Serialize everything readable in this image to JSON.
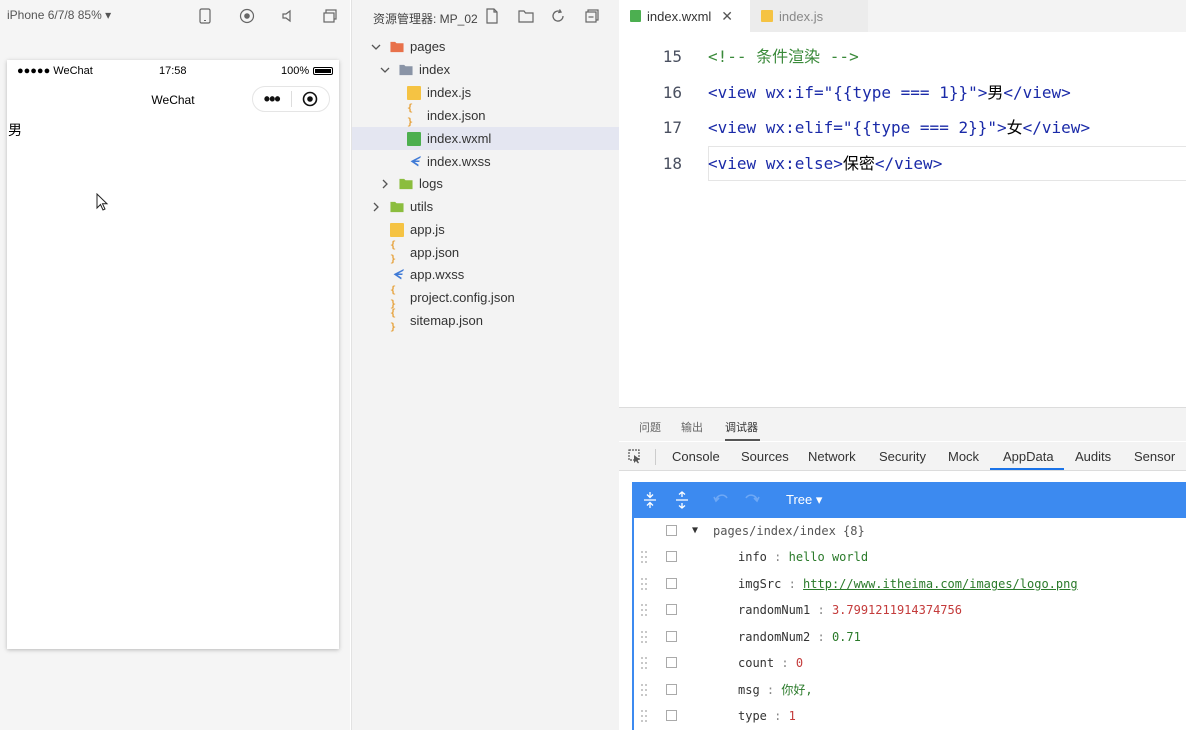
{
  "simulator": {
    "device_label": "iPhone 6/7/8 85% ▾",
    "status": {
      "signal": "●●●●● WeChat",
      "time": "17:58",
      "battery": "100%"
    },
    "nav_title": "WeChat",
    "page_text": "男"
  },
  "explorer": {
    "title": "资源管理器: MP_02",
    "tree": [
      {
        "label": "pages"
      },
      {
        "label": "index"
      },
      {
        "label": "index.js"
      },
      {
        "label": "index.json"
      },
      {
        "label": "index.wxml"
      },
      {
        "label": "index.wxss"
      },
      {
        "label": "logs"
      },
      {
        "label": "utils"
      },
      {
        "label": "app.js"
      },
      {
        "label": "app.json"
      },
      {
        "label": "app.wxss"
      },
      {
        "label": "project.config.json"
      },
      {
        "label": "sitemap.json"
      }
    ]
  },
  "editor": {
    "tabs": [
      {
        "label": "index.wxml"
      },
      {
        "label": "index.js"
      }
    ],
    "lines": [
      {
        "no": "15",
        "comment": "<!-- 条件渲染 -->"
      },
      {
        "no": "16",
        "open": "<view ",
        "attr": "wx:if=",
        "value": "\"{{type === 1}}\"",
        "close_open": ">",
        "text": "男",
        "end": "</view>"
      },
      {
        "no": "17",
        "open": "<view ",
        "attr": "wx:elif=",
        "value": "\"{{type === 2}}\"",
        "close_open": ">",
        "text": "女",
        "end": "</view>"
      },
      {
        "no": "18",
        "open": "<view ",
        "attr": "wx:else",
        "close_open": ">",
        "text": "保密",
        "end": "</view>"
      }
    ]
  },
  "panel": {
    "tabs": [
      "问题",
      "输出",
      "调试器"
    ],
    "devtools_tabs": [
      "Console",
      "Sources",
      "Network",
      "Security",
      "Mock",
      "AppData",
      "Audits",
      "Sensor"
    ],
    "tree_mode": "Tree ▾",
    "appdata": {
      "root": "pages/index/index {8}",
      "rows": [
        {
          "key": "info",
          "value": "hello world"
        },
        {
          "key": "imgSrc",
          "value": "http://www.itheima.com/images/logo.png"
        },
        {
          "key": "randomNum1",
          "value": "3.7991211914374756"
        },
        {
          "key": "randomNum2",
          "value": "0.71"
        },
        {
          "key": "count",
          "value": "0"
        },
        {
          "key": "msg",
          "value": "你好,"
        },
        {
          "key": "type",
          "value": "1"
        }
      ]
    }
  },
  "colors": {
    "accent": "#1a73e8",
    "appdata_toolbar": "#3c8af0",
    "selected_row": "#e4e6f1"
  }
}
